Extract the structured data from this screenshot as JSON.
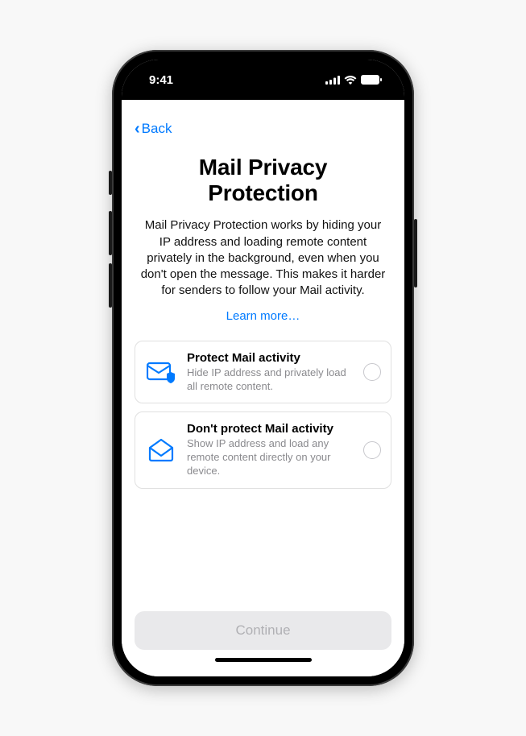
{
  "statusbar": {
    "time": "9:41"
  },
  "nav": {
    "back": "Back"
  },
  "header": {
    "title": "Mail Privacy Protection",
    "description": "Mail Privacy Protection works by hiding your IP address and loading remote content privately in the background, even when you don't open the message. This makes it harder for senders to follow your Mail activity.",
    "learn_more": "Learn more…"
  },
  "options": [
    {
      "title": "Protect Mail activity",
      "subtitle": "Hide IP address and privately load all remote content."
    },
    {
      "title": "Don't protect Mail activity",
      "subtitle": "Show IP address and load any remote content directly on your device."
    }
  ],
  "footer": {
    "continue": "Continue"
  }
}
